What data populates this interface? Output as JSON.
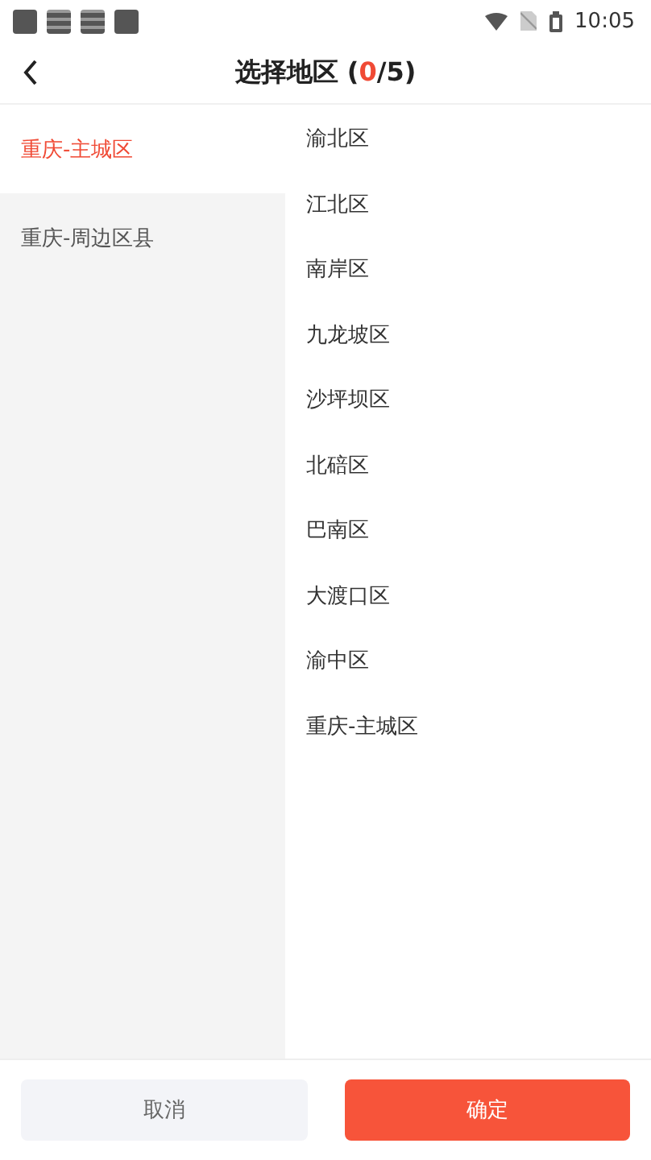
{
  "status_bar": {
    "time": "10:05"
  },
  "header": {
    "title_prefix": "选择地区 (",
    "selected_count": "0",
    "title_suffix": "/5)"
  },
  "categories": [
    {
      "label": "重庆-主城区",
      "selected": true
    },
    {
      "label": "重庆-周边区县",
      "selected": false
    }
  ],
  "districts": [
    {
      "label": "渝北区"
    },
    {
      "label": "江北区"
    },
    {
      "label": "南岸区"
    },
    {
      "label": "九龙坡区"
    },
    {
      "label": "沙坪坝区"
    },
    {
      "label": "北碚区"
    },
    {
      "label": "巴南区"
    },
    {
      "label": "大渡口区"
    },
    {
      "label": "渝中区"
    },
    {
      "label": "重庆-主城区"
    }
  ],
  "buttons": {
    "cancel": "取消",
    "confirm": "确定"
  }
}
